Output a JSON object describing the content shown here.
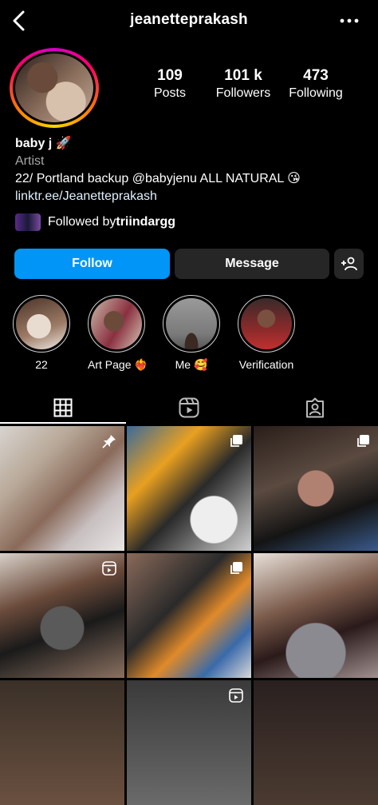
{
  "header": {
    "username": "jeanetteprakash"
  },
  "stats": {
    "posts": {
      "value": "109",
      "label": "Posts"
    },
    "followers": {
      "value": "101 k",
      "label": "Followers"
    },
    "following": {
      "value": "473",
      "label": "Following"
    }
  },
  "bio": {
    "name": "baby j 🚀",
    "category": "Artist",
    "text": "22/  Portland backup @babyjenu ALL NATURAL 😘",
    "link": "linktr.ee/Jeanetteprakash"
  },
  "followed_by": {
    "prefix": "Followed by ",
    "user": "triindargg"
  },
  "actions": {
    "follow": "Follow",
    "message": "Message"
  },
  "highlights": [
    {
      "label": "22"
    },
    {
      "label": "Art Page ❤️‍🔥"
    },
    {
      "label": "Me 🥰"
    },
    {
      "label": "Verification"
    }
  ],
  "tabs": [
    "grid-icon",
    "reels-icon",
    "tagged-icon"
  ],
  "colors": {
    "accent": "#0095f6",
    "secondary_button": "#262626",
    "background": "#000000"
  }
}
